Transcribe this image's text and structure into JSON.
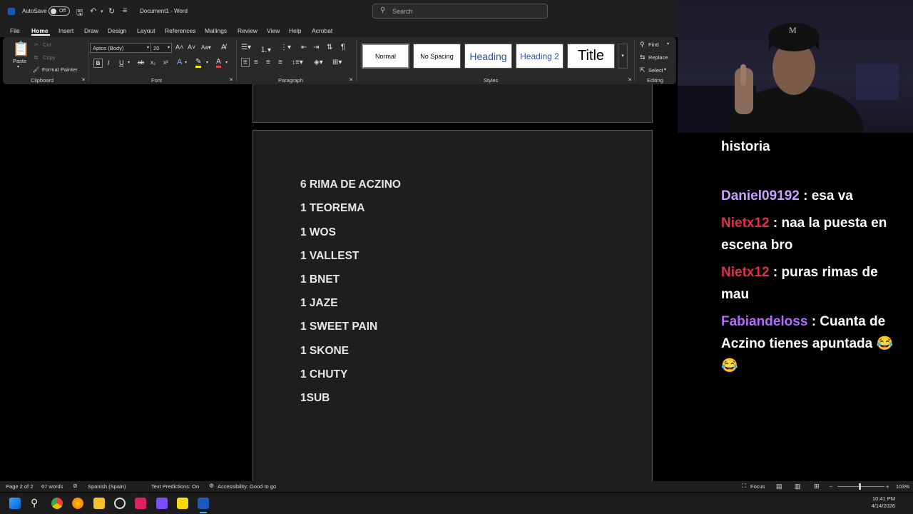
{
  "titlebar": {
    "autosave_label": "AutoSave",
    "autosave_state": "Off",
    "document_title": "Document1 - Word",
    "search_placeholder": "Search"
  },
  "menu": {
    "tabs": [
      "File",
      "Home",
      "Insert",
      "Draw",
      "Design",
      "Layout",
      "References",
      "Mailings",
      "Review",
      "View",
      "Help",
      "Acrobat"
    ],
    "active_tab": "Home"
  },
  "ribbon": {
    "clipboard": {
      "paste": "Paste",
      "cut": "Cut",
      "copy": "Copy",
      "format_painter": "Format Painter",
      "group": "Clipboard"
    },
    "font": {
      "family": "Aptos (Body)",
      "size": "20",
      "group": "Font",
      "bold": "B",
      "italic": "I",
      "underline": "U"
    },
    "paragraph": {
      "group": "Paragraph"
    },
    "styles": {
      "items": [
        "Normal",
        "No Spacing",
        "Heading",
        "Heading 2",
        "Title"
      ],
      "group": "Styles"
    },
    "editing": {
      "find": "Find",
      "replace": "Replace",
      "select": "Select",
      "group": "Editing"
    }
  },
  "document": {
    "lines": [
      "6 RIMA DE ACZINO",
      "1 TEOREMA",
      "1 WOS",
      "1 VALLEST",
      "1 BNET",
      "1 JAZE",
      "1 SWEET PAIN",
      "1 SKONE",
      "1 CHUTY",
      "1SUB"
    ]
  },
  "statusbar": {
    "page": "Page 2 of 2",
    "words": "67 words",
    "language": "Spanish (Spain)",
    "predictions": "Text Predictions: On",
    "accessibility": "Accessibility: Good to go",
    "focus": "Focus",
    "zoom": "103%"
  },
  "taskbar": {
    "time": "10:41 PM",
    "date": "4/14/2026"
  },
  "chat": {
    "partial_top": "historia",
    "messages": [
      {
        "user": "Daniel09192",
        "text": " : esa va",
        "color": "#c9a0ff"
      },
      {
        "user": "Nietx12",
        "text": " : naa la puesta en escena bro",
        "color": "#e0304a"
      },
      {
        "user": "Nietx12",
        "text": " : puras rimas de mau",
        "color": "#e0304a"
      },
      {
        "user": "Fabiandeloss",
        "text": " : Cuanta de Aczino tienes apuntada 😂 😂",
        "color": "#b36bff"
      }
    ]
  },
  "colors": {
    "accent": "#185abd",
    "word_bg": "#1f1f1f",
    "ribbon": "#292929"
  }
}
